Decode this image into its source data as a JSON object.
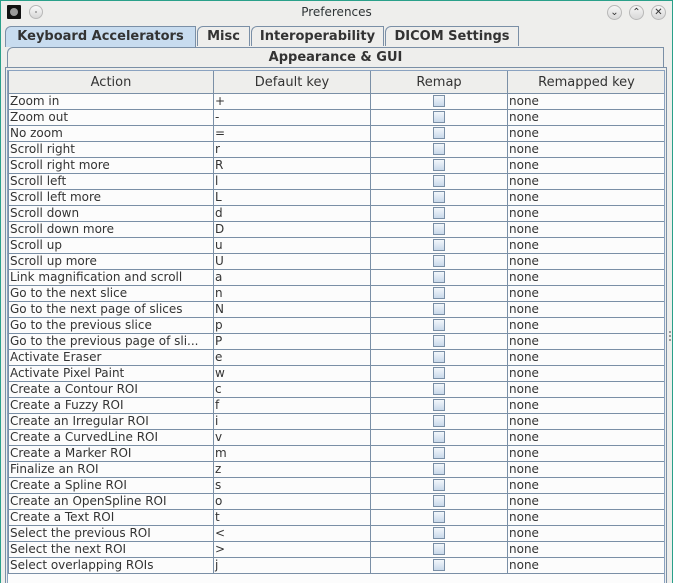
{
  "window": {
    "title": "Preferences",
    "buttons": {
      "minimize": "⌄",
      "maximize": "⌃",
      "close": "✕"
    }
  },
  "tabs": [
    {
      "label": "Keyboard Accelerators",
      "active": true
    },
    {
      "label": "Misc",
      "active": false
    },
    {
      "label": "Interoperability",
      "active": false
    },
    {
      "label": "DICOM Settings",
      "active": false
    }
  ],
  "tabs_row2": [
    {
      "label": "Appearance & GUI"
    }
  ],
  "table": {
    "columns": [
      "Action",
      "Default key",
      "Remap",
      "Remapped key"
    ],
    "rows": [
      {
        "action": "Zoom in",
        "key": "+",
        "remap": false,
        "remapped": "none"
      },
      {
        "action": "Zoom out",
        "key": "-",
        "remap": false,
        "remapped": "none"
      },
      {
        "action": "No zoom",
        "key": "=",
        "remap": false,
        "remapped": "none"
      },
      {
        "action": "Scroll right",
        "key": "r",
        "remap": false,
        "remapped": "none"
      },
      {
        "action": "Scroll right more",
        "key": "R",
        "remap": false,
        "remapped": "none"
      },
      {
        "action": "Scroll left",
        "key": "l",
        "remap": false,
        "remapped": "none"
      },
      {
        "action": "Scroll left more",
        "key": "L",
        "remap": false,
        "remapped": "none"
      },
      {
        "action": "Scroll down",
        "key": "d",
        "remap": false,
        "remapped": "none"
      },
      {
        "action": "Scroll down more",
        "key": "D",
        "remap": false,
        "remapped": "none"
      },
      {
        "action": "Scroll up",
        "key": "u",
        "remap": false,
        "remapped": "none"
      },
      {
        "action": "Scroll up more",
        "key": "U",
        "remap": false,
        "remapped": "none"
      },
      {
        "action": "Link magnification and scroll",
        "key": "a",
        "remap": false,
        "remapped": "none"
      },
      {
        "action": "Go to the next slice",
        "key": "n",
        "remap": false,
        "remapped": "none"
      },
      {
        "action": "Go to the next page of slices",
        "key": "N",
        "remap": false,
        "remapped": "none"
      },
      {
        "action": "Go to the previous slice",
        "key": "p",
        "remap": false,
        "remapped": "none"
      },
      {
        "action": "Go to the previous page of sli...",
        "key": "P",
        "remap": false,
        "remapped": "none"
      },
      {
        "action": "Activate Eraser",
        "key": "e",
        "remap": false,
        "remapped": "none"
      },
      {
        "action": "Activate Pixel Paint",
        "key": "w",
        "remap": false,
        "remapped": "none"
      },
      {
        "action": "Create a Contour ROI",
        "key": "c",
        "remap": false,
        "remapped": "none"
      },
      {
        "action": "Create a Fuzzy ROI",
        "key": "f",
        "remap": false,
        "remapped": "none"
      },
      {
        "action": "Create an Irregular ROI",
        "key": "i",
        "remap": false,
        "remapped": "none"
      },
      {
        "action": "Create a CurvedLine ROI",
        "key": "v",
        "remap": false,
        "remapped": "none"
      },
      {
        "action": "Create a Marker ROI",
        "key": "m",
        "remap": false,
        "remapped": "none"
      },
      {
        "action": "Finalize an ROI",
        "key": "z",
        "remap": false,
        "remapped": "none"
      },
      {
        "action": "Create a Spline ROI",
        "key": "s",
        "remap": false,
        "remapped": "none"
      },
      {
        "action": "Create an OpenSpline ROI",
        "key": "o",
        "remap": false,
        "remapped": "none"
      },
      {
        "action": "Create a Text ROI",
        "key": "t",
        "remap": false,
        "remapped": "none"
      },
      {
        "action": "Select the previous ROI",
        "key": "<",
        "remap": false,
        "remapped": "none"
      },
      {
        "action": "Select the next ROI",
        "key": ">",
        "remap": false,
        "remapped": "none"
      },
      {
        "action": "Select overlapping ROIs",
        "key": "j",
        "remap": false,
        "remapped": "none"
      }
    ]
  }
}
